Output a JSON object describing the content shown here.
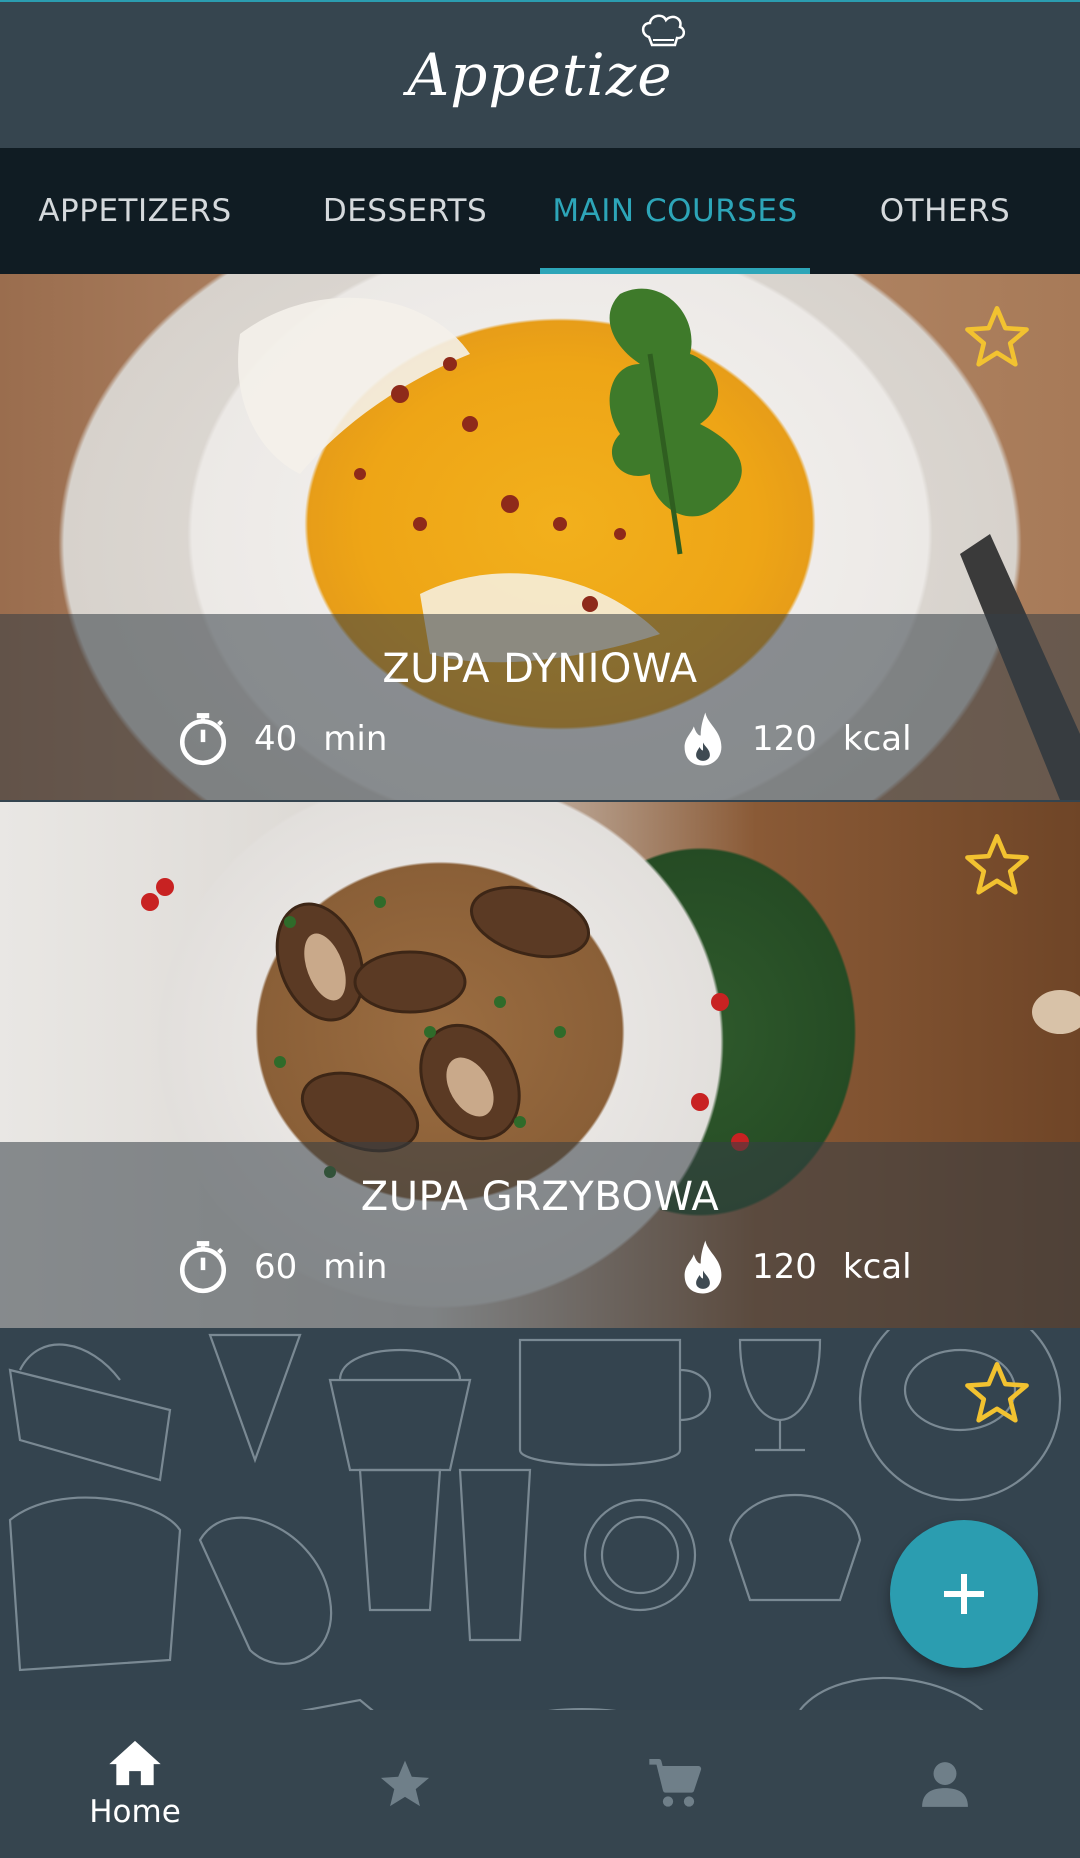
{
  "app": {
    "logo_text": "Appetize"
  },
  "tabs": [
    {
      "label": "APPETIZERS",
      "active": false
    },
    {
      "label": "DESSERTS",
      "active": false
    },
    {
      "label": "MAIN COURSES",
      "active": true
    },
    {
      "label": "OTHERS",
      "active": false
    }
  ],
  "recipes": [
    {
      "title": "ZUPA DYNIOWA",
      "time": "40",
      "time_unit": "min",
      "calories": "120",
      "calories_unit": "kcal",
      "favorite": false
    },
    {
      "title": "ZUPA GRZYBOWA",
      "time": "60",
      "time_unit": "min",
      "calories": "120",
      "calories_unit": "kcal",
      "favorite": false
    },
    {
      "favorite": false
    }
  ],
  "bottom_nav": [
    {
      "label": "Home",
      "icon": "home-icon",
      "active": true
    },
    {
      "label": "",
      "icon": "star-icon",
      "active": false
    },
    {
      "label": "",
      "icon": "cart-icon",
      "active": false
    },
    {
      "label": "",
      "icon": "person-icon",
      "active": false
    }
  ],
  "colors": {
    "accent": "#2b9db0",
    "appbar": "#36454f",
    "tabbar": "#101c23",
    "star": "#f2c230",
    "inactive_icon": "#6f7f89"
  }
}
